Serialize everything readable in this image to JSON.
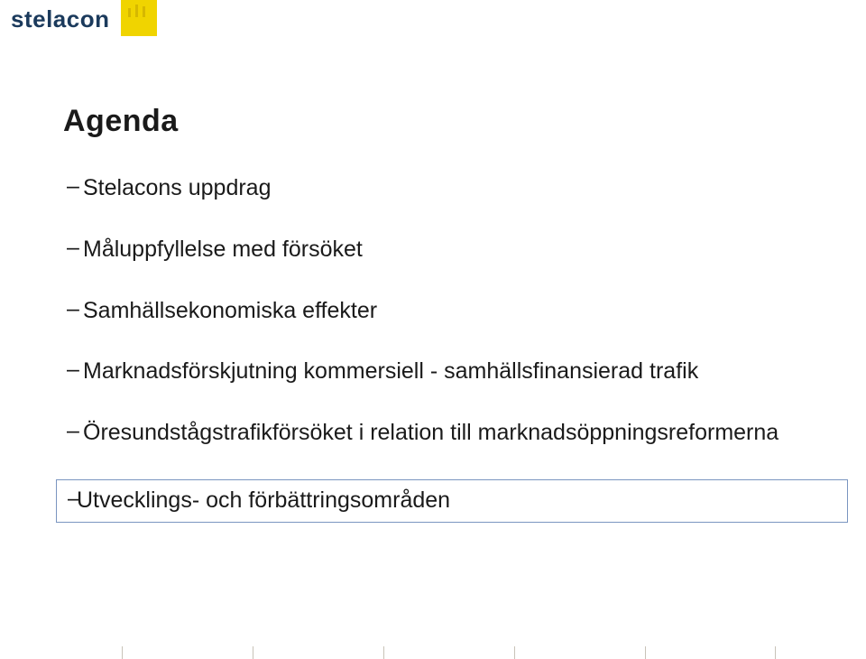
{
  "brand": {
    "name": "stelacon"
  },
  "title": "Agenda",
  "items": [
    {
      "text": "Stelacons uppdrag",
      "highlight": false
    },
    {
      "text": "Måluppfyllelse med försöket",
      "highlight": false
    },
    {
      "text": "Samhällsekonomiska effekter",
      "highlight": false
    },
    {
      "text": "Marknadsförskjutning kommersiell - samhällsfinansierad trafik",
      "highlight": false
    },
    {
      "text": "Öresundstågstrafikförsöket i relation till marknadsöppningsreformerna",
      "highlight": false
    },
    {
      "text": "Utvecklings- och förbättringsområden",
      "highlight": true
    }
  ]
}
